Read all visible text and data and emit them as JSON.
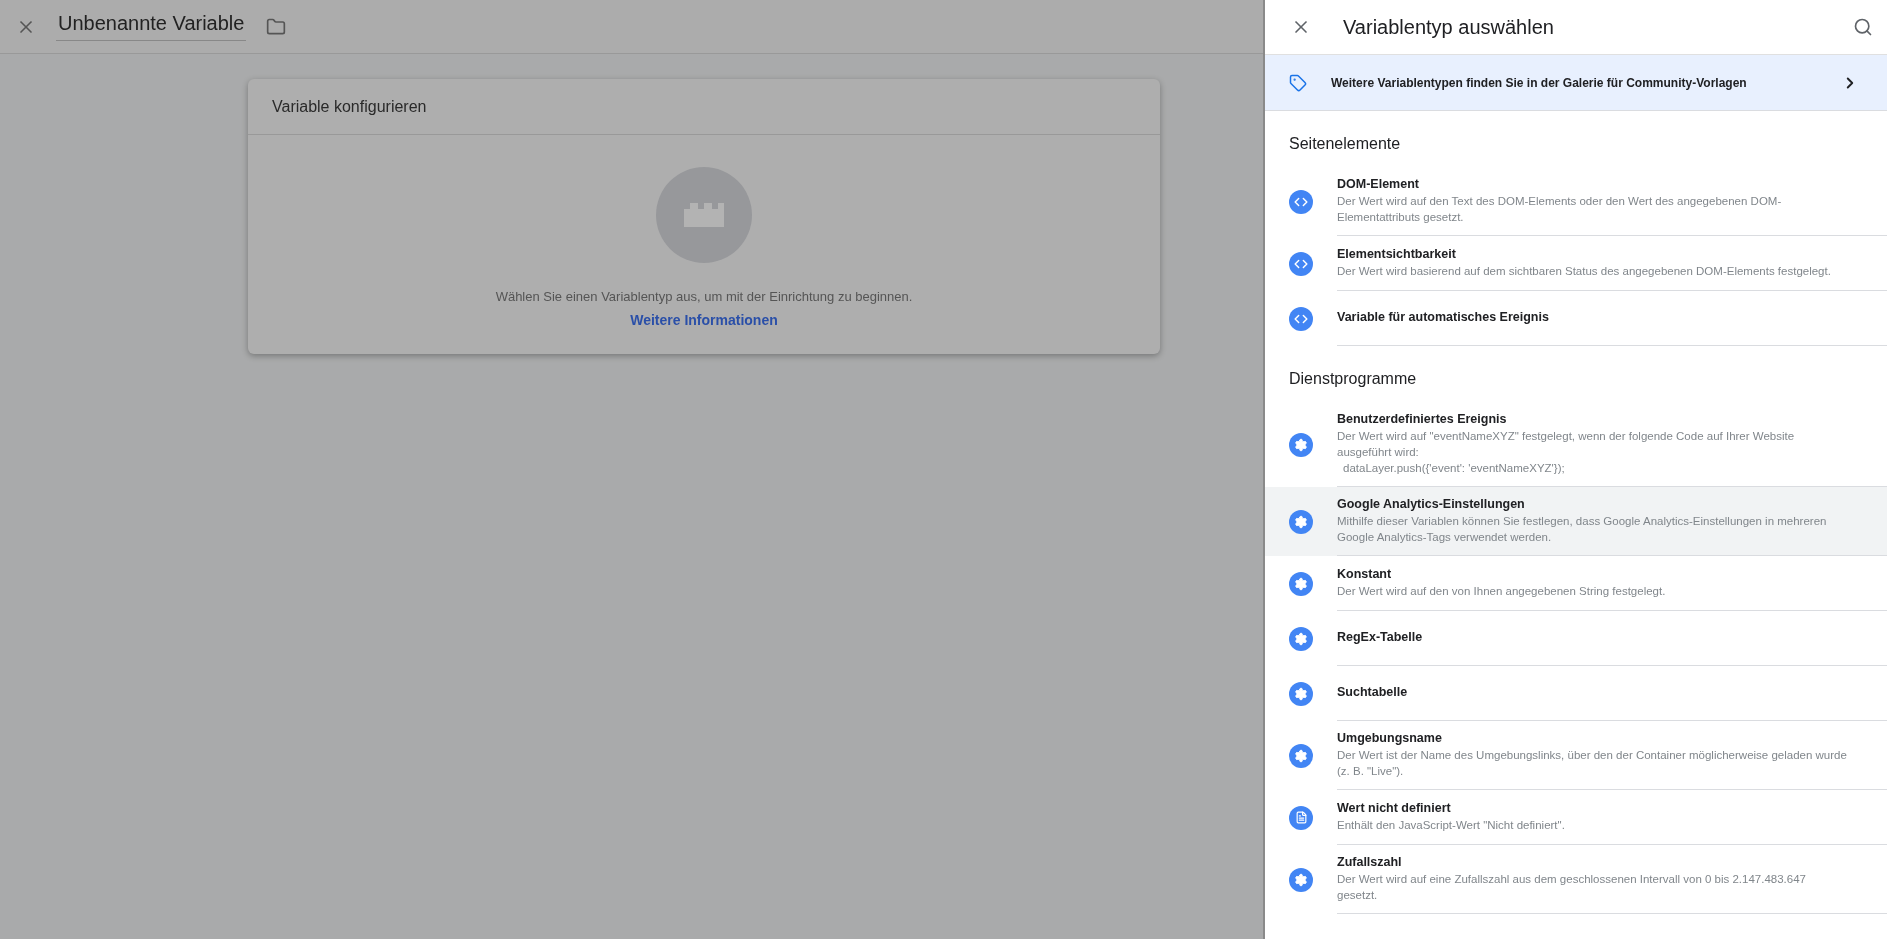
{
  "editor": {
    "title": "Unbenannte Variable"
  },
  "config_card": {
    "title": "Variable konfigurieren",
    "message": "Wählen Sie einen Variablentyp aus, um mit der Einrichtung zu beginnen.",
    "link": "Weitere Informationen"
  },
  "picker": {
    "title": "Variablentyp auswählen",
    "gallery_banner": "Weitere Variablentypen finden Sie in der Galerie für Community-Vorlagen",
    "sections": [
      {
        "heading": "Seitenelemente",
        "items": [
          {
            "kind": "code",
            "title": "DOM-Element",
            "description": "Der Wert wird auf den Text des DOM-Elements oder den Wert des angegebenen DOM-Elementattributs gesetzt.",
            "highlighted": false
          },
          {
            "kind": "code",
            "title": "Elementsichtbarkeit",
            "description": "Der Wert wird basierend auf dem sichtbaren Status des angegebenen DOM-Elements festgelegt.",
            "highlighted": false
          },
          {
            "kind": "code",
            "title": "Variable für automatisches Ereignis",
            "highlighted": false
          }
        ]
      },
      {
        "heading": "Dienstprogramme",
        "items": [
          {
            "kind": "gear",
            "title": "Benutzerdefiniertes Ereignis",
            "description": "Der Wert wird auf \"eventNameXYZ\" festgelegt, wenn der folgende Code auf Ihrer Website ausgeführt wird:",
            "code": "dataLayer.push({'event': 'eventNameXYZ'});",
            "highlighted": false
          },
          {
            "kind": "gear",
            "title": "Google Analytics-Einstellungen",
            "description": "Mithilfe dieser Variablen können Sie festlegen, dass Google Analytics-Einstellungen in mehreren Google Analytics-Tags verwendet werden.",
            "highlighted": true
          },
          {
            "kind": "gear",
            "title": "Konstant",
            "description": "Der Wert wird auf den von Ihnen angegebenen String festgelegt.",
            "highlighted": false
          },
          {
            "kind": "gear",
            "title": "RegEx-Tabelle",
            "highlighted": false
          },
          {
            "kind": "gear",
            "title": "Suchtabelle",
            "highlighted": false
          },
          {
            "kind": "gear",
            "title": "Umgebungsname",
            "description": "Der Wert ist der Name des Umgebungslinks, über den der Container möglicherweise geladen wurde (z. B. \"Live\").",
            "highlighted": false
          },
          {
            "kind": "doc",
            "title": "Wert nicht definiert",
            "description": "Enthält den JavaScript-Wert \"Nicht definiert\".",
            "highlighted": false
          },
          {
            "kind": "gear",
            "title": "Zufallszahl",
            "description": "Der Wert wird auf eine Zufallszahl aus dem geschlossenen Intervall von 0 bis 2.147.483.647 gesetzt.",
            "highlighted": false
          }
        ]
      }
    ]
  }
}
